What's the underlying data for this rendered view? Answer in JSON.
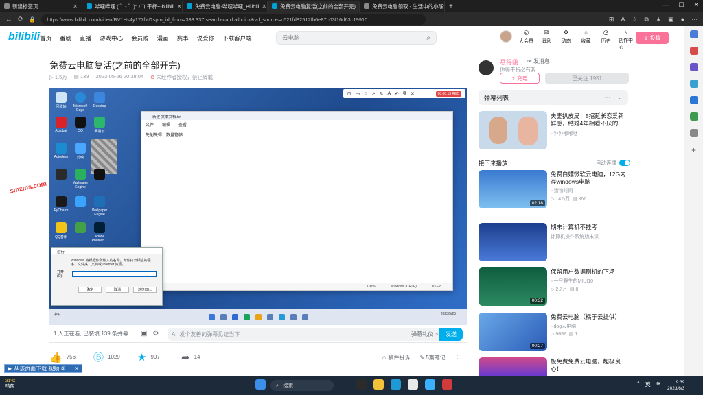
{
  "browser": {
    "tabs": [
      {
        "title": "新建标签页",
        "active": false
      },
      {
        "title": "哔哩哔哩 ( ゜- ゜)つロ 干杯~-bilibili",
        "active": false
      },
      {
        "title": "免费云电脑-哔哩哔哩_Bilibili",
        "active": false
      },
      {
        "title": "免费云电脑复活(之前的全部开完)",
        "active": true
      },
      {
        "title": "免费云电脑领取 - 生活中的小确幸",
        "active": false
      }
    ],
    "url": "https://www.bilibili.com/video/BV1Hs4y177fY/?spm_id_from=333.337.search-card.all.click&vd_source=c521fd82512fb6e87c03f16d63c19910"
  },
  "header": {
    "logo": "bilibili",
    "nav": [
      "首页",
      "番剧",
      "直播",
      "游戏中心",
      "会员购",
      "漫画",
      "赛事",
      "说爱你",
      "下载客户端"
    ],
    "search_placeholder": "云电脑",
    "icons": [
      {
        "label": "大会员",
        "icon": "vip-icon"
      },
      {
        "label": "消息",
        "icon": "message-icon"
      },
      {
        "label": "动态",
        "icon": "dynamic-icon"
      },
      {
        "label": "收藏",
        "icon": "star-icon"
      },
      {
        "label": "历史",
        "icon": "history-icon"
      },
      {
        "label": "创作中心",
        "icon": "bulb-icon"
      }
    ],
    "post_button": "投稿"
  },
  "video": {
    "title": "免费云电脑复活(之前的全部开完)",
    "views": "1.5万",
    "danmaku_count": "139",
    "date": "2023-05-26 20:38:04",
    "copyright": "未经作者授权，禁止转载"
  },
  "player": {
    "notepad_title": "新建 文本文档.txt",
    "notepad_menu": [
      "文件",
      "编辑",
      "查看"
    ],
    "notepad_text": "先削先得，数量管够",
    "notepad_status": [
      "100%",
      "Windows (CRLF)",
      "UTF-8"
    ],
    "run_title": "运行",
    "run_desc": "Windows 将根据你所输入的名称，为你打开相应的程序、文件夹、文档或 Internet 资源。",
    "run_label": "打开(O):",
    "run_buttons": [
      "确定",
      "取消",
      "浏览(B)..."
    ],
    "desktop_icons": [
      "回收站",
      "Microsoft Edge",
      "Desktop",
      "Acrobat",
      "QQ",
      "网易云",
      "Autodesk",
      "剪映",
      "",
      "Wallpaper Engine",
      "",
      "",
      "PyCharm",
      "",
      "Wallpaper Engine",
      "QQ音乐",
      "",
      "Adobe Photosh..."
    ],
    "annot_rec": "00:00:13 REC",
    "taskbar_weather": "中午",
    "taskbar_clock": "2023/5/25"
  },
  "danmaku": {
    "watching": "1 人正在看, 已装填 139 条弹幕",
    "input_placeholder": "发个友善的弹幕见证当下",
    "etiquette": "弹幕礼仪 >",
    "send": "发送"
  },
  "actions": [
    {
      "icon": "like-icon",
      "count": "756"
    },
    {
      "icon": "coin-icon",
      "count": "1029"
    },
    {
      "icon": "favorite-icon",
      "count": "907"
    },
    {
      "icon": "share-icon",
      "count": "14"
    }
  ],
  "actions_right": [
    "稿件投诉",
    "5篇笔记"
  ],
  "overlay": {
    "watermark_text": "smzms.com",
    "download_bar": "从该页面下载 视频 ②"
  },
  "uploader": {
    "name": "悬得函",
    "message": "发消息",
    "sign": "你得干货必有我",
    "charge": "充电",
    "follow": "已关注 1951"
  },
  "danmaku_list": "弹幕列表",
  "ad": {
    "title": "夫妻扒皮局！5招延长恋爱新鲜感，结婚4年相看不厌的...",
    "author": "钟钟嘟嘟哒"
  },
  "up_next_label": "接下来播放",
  "autoplay_label": "自动连播",
  "recommendations": [
    {
      "title": "免费白嫖微软云电脑，12G内存windows电脑",
      "author": "猎物时间",
      "views": "14.5万",
      "danmaku": "366",
      "duration": "02:18"
    },
    {
      "title": "期末计算机不挂考",
      "author": "计算机操作系统期末课",
      "views": "",
      "danmaku": "",
      "duration": ""
    },
    {
      "title": "保留用户数据刷机的下场",
      "author": "一只野生的MIUI10",
      "views": "2.7万",
      "danmaku": "8",
      "duration": "00:32"
    },
    {
      "title": "免费云电脑（橘子云提供）",
      "author": "dog云电脑",
      "views": "9697",
      "danmaku": "1",
      "duration": "00:27"
    },
    {
      "title": "极免费免费云电脑，超极良心！",
      "author": "",
      "views": "",
      "danmaku": "",
      "duration": ""
    }
  ],
  "taskbar": {
    "weather_temp": "31°C",
    "weather_desc": "晴朗",
    "search": "搜索",
    "ime": "英",
    "time": "9:39",
    "date": "2023/6/3"
  },
  "colors": {
    "accent_blue": "#00aeec",
    "accent_pink": "#fb7299"
  }
}
